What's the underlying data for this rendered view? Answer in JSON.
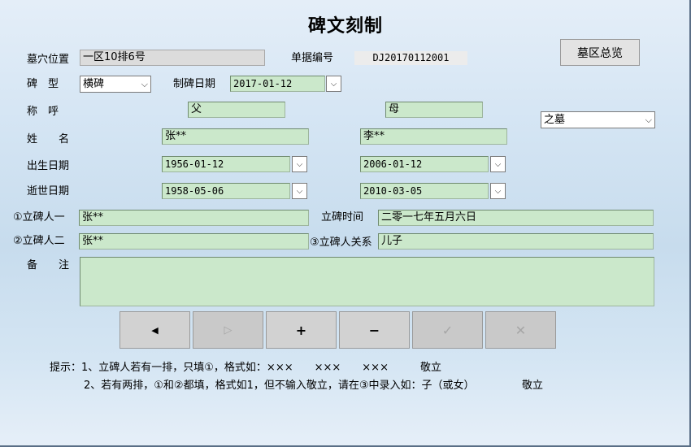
{
  "title": "碑文刻制",
  "top_button": "墓区总览",
  "location": {
    "label": "墓穴位置",
    "value": "一区10排6号"
  },
  "document_no": {
    "label": "单据编号",
    "value": "DJ20170112001"
  },
  "stele_type": {
    "label": "碑　型",
    "value": "横碑"
  },
  "made_date": {
    "label": "制碑日期",
    "value": "2017-01-12"
  },
  "title_label": "称　呼",
  "name_label": "姓　　名",
  "birth_label": "出生日期",
  "death_label": "逝世日期",
  "person1": {
    "title": "父",
    "name": "张**",
    "birth": "1956-01-12",
    "death": "1958-05-06"
  },
  "person2": {
    "title": "母",
    "name": "李**",
    "birth": "2006-01-12",
    "death": "2010-03-05"
  },
  "suffix": {
    "value": "之墓"
  },
  "erector1": {
    "label": "①立碑人一",
    "value": "张**"
  },
  "erector2": {
    "label": "②立碑人二",
    "value": "张**"
  },
  "erect_time": {
    "label": "立碑时间",
    "value": "二零一七年五月六日"
  },
  "relation": {
    "label": "③立碑人关系",
    "value": "儿子"
  },
  "remark": {
    "label": "备　　注",
    "value": ""
  },
  "nav": {
    "prev": "◀",
    "next": "▷",
    "add": "+",
    "delete": "−",
    "save": "✓",
    "cancel": "✕"
  },
  "hint": {
    "line1": "提示：1、立碑人若有一排，只填①，格式如：×××　　×××　　×××　　　敬立",
    "line2": "2、若有两排，①和②都填，格式如1，但不输入敬立，请在③中录入如：子（或女）　　　　　敬立"
  },
  "colors": {
    "field_green": "#cbe8cb",
    "field_gray": "#dcdcdc",
    "button_gray": "#d2d2d2"
  }
}
